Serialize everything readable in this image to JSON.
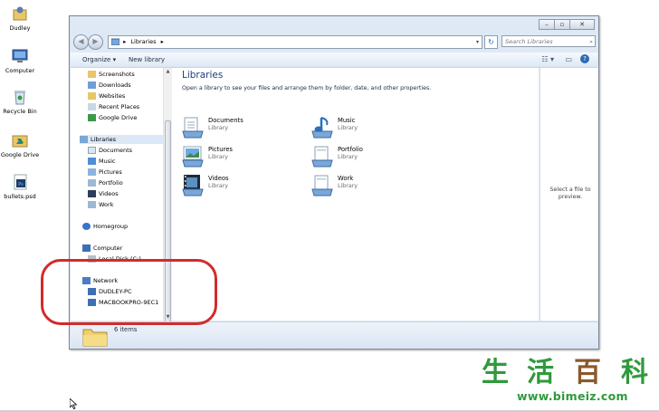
{
  "desktop": {
    "icons": [
      {
        "label": "Dudley",
        "icon": "user-folder-icon"
      },
      {
        "label": "Computer",
        "icon": "computer-icon"
      },
      {
        "label": "Recycle Bin",
        "icon": "recycle-bin-icon"
      },
      {
        "label": "Google Drive",
        "icon": "google-drive-icon"
      },
      {
        "label": "bullets.psd",
        "icon": "photoshop-file-icon"
      }
    ]
  },
  "window": {
    "address": {
      "crumb": "Libraries",
      "separator": "▸"
    },
    "search_placeholder": "Search Libraries",
    "toolbar": {
      "organize": "Organize ▾",
      "new_library": "New library"
    },
    "nav": {
      "favorites": [
        "Screenshots",
        "Downloads",
        "Websites",
        "Recent Places",
        "Google Drive"
      ],
      "libraries_label": "Libraries",
      "libraries": [
        "Documents",
        "Music",
        "Pictures",
        "Portfolio",
        "Videos",
        "Work"
      ],
      "homegroup": "Homegroup",
      "computer": "Computer",
      "local_disk": "Local Disk (C:)",
      "network": "Network",
      "network_items": [
        "DUDLEY-PC",
        "MACBOOKPRO-9EC1"
      ]
    },
    "content": {
      "title": "Libraries",
      "subtitle": "Open a library to see your files and arrange them by folder, date, and other properties.",
      "libraries": [
        {
          "name": "Documents",
          "kind": "Library"
        },
        {
          "name": "Music",
          "kind": "Library"
        },
        {
          "name": "Pictures",
          "kind": "Library"
        },
        {
          "name": "Portfolio",
          "kind": "Library"
        },
        {
          "name": "Videos",
          "kind": "Library"
        },
        {
          "name": "Work",
          "kind": "Library"
        }
      ]
    },
    "preview_text": "Select a file to preview.",
    "details": {
      "count": "6 items"
    }
  },
  "watermark": {
    "chars": [
      "生",
      "活",
      "百",
      "科"
    ],
    "url": "www.bimeiz.com",
    "colors": {
      "green": "#2f9a3c",
      "brown": "#8a5a2b"
    }
  },
  "accent": {
    "highlight": "#d22b2b",
    "title": "#1e3e7c"
  }
}
